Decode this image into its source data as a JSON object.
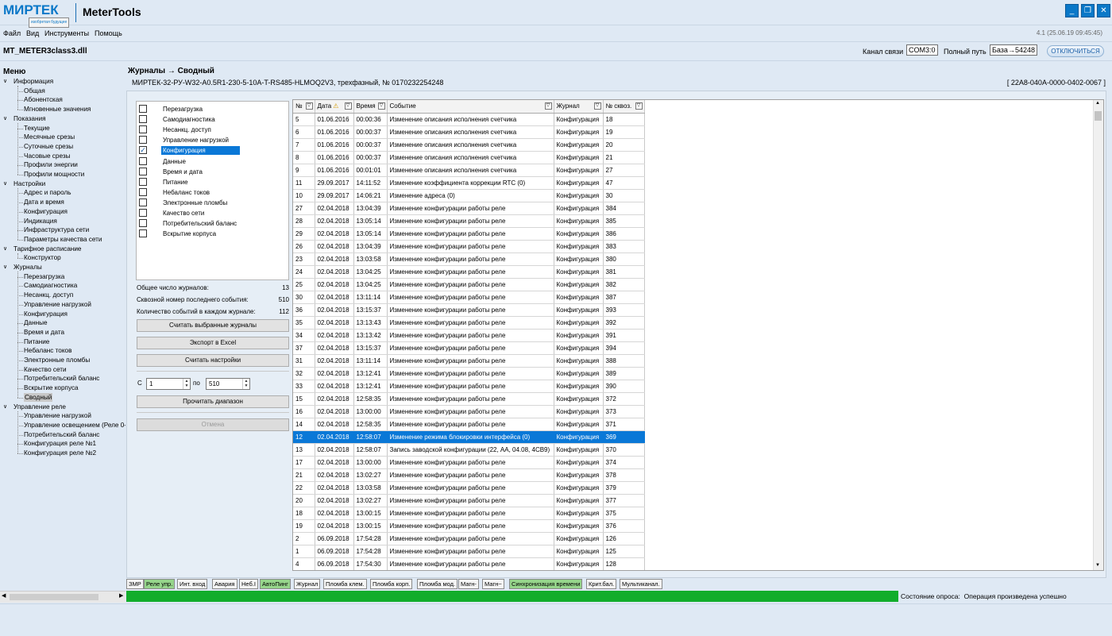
{
  "titlebar": {
    "logo": "МИРТЕК",
    "logo_tagline": "изобретая будущее",
    "app_title": "MeterTools",
    "minimize": "_",
    "maximize": "❐",
    "close": "✕"
  },
  "menubar": {
    "items": [
      "Файл",
      "Вид",
      "Инструменты",
      "Помощь"
    ],
    "version": "4.1 (25.06.19 09:45:45)"
  },
  "dllrow": {
    "dll": "MT_METER3class3.dll",
    "channel_label": "Канал связи",
    "channel_value": "COM3:0",
    "path_label": "Полный путь",
    "path_value": "База→54248",
    "disconnect": "ОТКЛЮЧИТЬСЯ"
  },
  "sidebar": {
    "header": "Меню",
    "tree": [
      {
        "label": "Информация",
        "level": 0,
        "expander": "∨"
      },
      {
        "label": "Общая",
        "level": 1
      },
      {
        "label": "Абонентская",
        "level": 1
      },
      {
        "label": "Мгновенные значения",
        "level": 1
      },
      {
        "label": "Показания",
        "level": 0,
        "expander": "∨"
      },
      {
        "label": "Текущие",
        "level": 1
      },
      {
        "label": "Месячные срезы",
        "level": 1
      },
      {
        "label": "Суточные срезы",
        "level": 1
      },
      {
        "label": "Часовые срезы",
        "level": 1
      },
      {
        "label": "Профили энергии",
        "level": 1
      },
      {
        "label": "Профили мощности",
        "level": 1
      },
      {
        "label": "Настройки",
        "level": 0,
        "expander": "∨"
      },
      {
        "label": "Адрес и пароль",
        "level": 1
      },
      {
        "label": "Дата и время",
        "level": 1
      },
      {
        "label": "Конфигурация",
        "level": 1
      },
      {
        "label": "Индикация",
        "level": 1
      },
      {
        "label": "Инфраструктура сети",
        "level": 1
      },
      {
        "label": "Параметры качества сети",
        "level": 1
      },
      {
        "label": "Тарифное расписание",
        "level": 0,
        "expander": "∨"
      },
      {
        "label": "Конструктор",
        "level": 1
      },
      {
        "label": "Журналы",
        "level": 0,
        "expander": "∨"
      },
      {
        "label": "Перезагрузка",
        "level": 1
      },
      {
        "label": "Самодиагностика",
        "level": 1
      },
      {
        "label": "Несанкц. доступ",
        "level": 1
      },
      {
        "label": "Управление нагрузкой",
        "level": 1
      },
      {
        "label": "Конфигурация",
        "level": 1
      },
      {
        "label": "Данные",
        "level": 1
      },
      {
        "label": "Время и дата",
        "level": 1
      },
      {
        "label": "Питание",
        "level": 1
      },
      {
        "label": "Небаланс токов",
        "level": 1
      },
      {
        "label": "Электронные пломбы",
        "level": 1
      },
      {
        "label": "Качество сети",
        "level": 1
      },
      {
        "label": "Потребительский баланс",
        "level": 1
      },
      {
        "label": "Вскрытие корпуса",
        "level": 1
      },
      {
        "label": "Сводный",
        "level": 1,
        "selected": true
      },
      {
        "label": "Управление реле",
        "level": 0,
        "expander": "∨"
      },
      {
        "label": "Управление нагрузкой",
        "level": 1
      },
      {
        "label": "Управление освещением (Реле 0-4",
        "level": 1
      },
      {
        "label": "Потребительский баланс",
        "level": 1
      },
      {
        "label": "Конфигурация реле №1",
        "level": 1
      },
      {
        "label": "Конфигурация реле №2",
        "level": 1
      }
    ]
  },
  "main": {
    "title": "Журналы → Сводный",
    "meter": "МИРТЕК-32-РУ-W32-A0.5R1-230-5-10A-T-RS485-HLMOQ2V3, трехфазный, № 0170232254248",
    "serial": "[ 22A8-040A-0000-0402-0067 ]"
  },
  "journals": [
    {
      "label": "Перезагрузка",
      "checked": false
    },
    {
      "label": "Самодиагностика",
      "checked": false
    },
    {
      "label": "Несанкц. доступ",
      "checked": false
    },
    {
      "label": "Управление нагрузкой",
      "checked": false
    },
    {
      "label": "Конфигурация",
      "checked": true,
      "selected": true
    },
    {
      "label": "Данные",
      "checked": false
    },
    {
      "label": "Время и дата",
      "checked": false
    },
    {
      "label": "Питание",
      "checked": false
    },
    {
      "label": "Небаланс токов",
      "checked": false
    },
    {
      "label": "Электронные пломбы",
      "checked": false
    },
    {
      "label": "Качество сети",
      "checked": false
    },
    {
      "label": "Потребительский баланс",
      "checked": false
    },
    {
      "label": "Вскрытие корпуса",
      "checked": false
    }
  ],
  "stats": {
    "total_label": "Общее число журналов:",
    "total_value": "13",
    "last_label": "Сквозной номер последнего события:",
    "last_value": "510",
    "each_label": "Количество событий в каждом журнале:",
    "each_value": "112"
  },
  "buttons": {
    "read_selected": "Считать выбранные журналы",
    "export": "Экспорт в Excel",
    "read_settings": "Считать настройки",
    "read_range": "Прочитать диапазон",
    "cancel": "Отмена"
  },
  "range": {
    "from_label": "С",
    "from_value": "1",
    "to_label": "по",
    "to_value": "510",
    "up": "▲",
    "down": "▼"
  },
  "table": {
    "filter_glyph": "▽",
    "warn_glyph": "⚠",
    "columns": [
      "№",
      "Дата",
      "Время",
      "Событие",
      "Журнал",
      "№ сквоз."
    ],
    "rows": [
      [
        "5",
        "01.06.2016",
        "00:00:36",
        "Изменение описания исполнения счетчика",
        "Конфигурация",
        "18"
      ],
      [
        "6",
        "01.06.2016",
        "00:00:37",
        "Изменение описания исполнения счетчика",
        "Конфигурация",
        "19"
      ],
      [
        "7",
        "01.06.2016",
        "00:00:37",
        "Изменение описания исполнения счетчика",
        "Конфигурация",
        "20"
      ],
      [
        "8",
        "01.06.2016",
        "00:00:37",
        "Изменение описания исполнения счетчика",
        "Конфигурация",
        "21"
      ],
      [
        "9",
        "01.06.2016",
        "00:01:01",
        "Изменение описания исполнения счетчика",
        "Конфигурация",
        "27"
      ],
      [
        "11",
        "29.09.2017",
        "14:11:52",
        "Изменение коэффициента коррекции RTC (0)",
        "Конфигурация",
        "47"
      ],
      [
        "10",
        "29.09.2017",
        "14:06:21",
        "Изменение адреса (0)",
        "Конфигурация",
        "30"
      ],
      [
        "27",
        "02.04.2018",
        "13:04:39",
        "Изменение конфигурации работы реле",
        "Конфигурация",
        "384"
      ],
      [
        "28",
        "02.04.2018",
        "13:05:14",
        "Изменение конфигурации работы реле",
        "Конфигурация",
        "385"
      ],
      [
        "29",
        "02.04.2018",
        "13:05:14",
        "Изменение конфигурации работы реле",
        "Конфигурация",
        "386"
      ],
      [
        "26",
        "02.04.2018",
        "13:04:39",
        "Изменение конфигурации работы реле",
        "Конфигурация",
        "383"
      ],
      [
        "23",
        "02.04.2018",
        "13:03:58",
        "Изменение конфигурации работы реле",
        "Конфигурация",
        "380"
      ],
      [
        "24",
        "02.04.2018",
        "13:04:25",
        "Изменение конфигурации работы реле",
        "Конфигурация",
        "381"
      ],
      [
        "25",
        "02.04.2018",
        "13:04:25",
        "Изменение конфигурации работы реле",
        "Конфигурация",
        "382"
      ],
      [
        "30",
        "02.04.2018",
        "13:11:14",
        "Изменение конфигурации работы реле",
        "Конфигурация",
        "387"
      ],
      [
        "36",
        "02.04.2018",
        "13:15:37",
        "Изменение конфигурации работы реле",
        "Конфигурация",
        "393"
      ],
      [
        "35",
        "02.04.2018",
        "13:13:43",
        "Изменение конфигурации работы реле",
        "Конфигурация",
        "392"
      ],
      [
        "34",
        "02.04.2018",
        "13:13:42",
        "Изменение конфигурации работы реле",
        "Конфигурация",
        "391"
      ],
      [
        "37",
        "02.04.2018",
        "13:15:37",
        "Изменение конфигурации работы реле",
        "Конфигурация",
        "394"
      ],
      [
        "31",
        "02.04.2018",
        "13:11:14",
        "Изменение конфигурации работы реле",
        "Конфигурация",
        "388"
      ],
      [
        "32",
        "02.04.2018",
        "13:12:41",
        "Изменение конфигурации работы реле",
        "Конфигурация",
        "389"
      ],
      [
        "33",
        "02.04.2018",
        "13:12:41",
        "Изменение конфигурации работы реле",
        "Конфигурация",
        "390"
      ],
      [
        "15",
        "02.04.2018",
        "12:58:35",
        "Изменение конфигурации работы реле",
        "Конфигурация",
        "372"
      ],
      [
        "16",
        "02.04.2018",
        "13:00:00",
        "Изменение конфигурации работы реле",
        "Конфигурация",
        "373"
      ],
      [
        "14",
        "02.04.2018",
        "12:58:35",
        "Изменение конфигурации работы реле",
        "Конфигурация",
        "371"
      ],
      [
        "12",
        "02.04.2018",
        "12:58:07",
        "Изменение режима блокировки интерфейса (0)",
        "Конфигурация",
        "369"
      ],
      [
        "13",
        "02.04.2018",
        "12:58:07",
        "Запись заводской конфигурации (22, AA, 04.08, 4CB9)",
        "Конфигурация",
        "370"
      ],
      [
        "17",
        "02.04.2018",
        "13:00:00",
        "Изменение конфигурации работы реле",
        "Конфигурация",
        "374"
      ],
      [
        "21",
        "02.04.2018",
        "13:02:27",
        "Изменение конфигурации работы реле",
        "Конфигурация",
        "378"
      ],
      [
        "22",
        "02.04.2018",
        "13:03:58",
        "Изменение конфигурации работы реле",
        "Конфигурация",
        "379"
      ],
      [
        "20",
        "02.04.2018",
        "13:02:27",
        "Изменение конфигурации работы реле",
        "Конфигурация",
        "377"
      ],
      [
        "18",
        "02.04.2018",
        "13:00:15",
        "Изменение конфигурации работы реле",
        "Конфигурация",
        "375"
      ],
      [
        "19",
        "02.04.2018",
        "13:00:15",
        "Изменение конфигурации работы реле",
        "Конфигурация",
        "376"
      ],
      [
        "2",
        "06.09.2018",
        "17:54:28",
        "Изменение конфигурации работы реле",
        "Конфигурация",
        "126"
      ],
      [
        "1",
        "06.09.2018",
        "17:54:28",
        "Изменение конфигурации работы реле",
        "Конфигурация",
        "125"
      ],
      [
        "4",
        "06.09.2018",
        "17:54:30",
        "Изменение конфигурации работы реле",
        "Конфигурация",
        "128"
      ]
    ],
    "selected_row": 25
  },
  "tags": [
    {
      "label": "ЗМР",
      "on": false
    },
    {
      "label": "Реле упр.",
      "on": true
    },
    {
      "label": "Инт. вход",
      "on": false
    },
    {
      "label": "Авария",
      "on": false
    },
    {
      "label": "Неб.I",
      "on": false
    },
    {
      "label": "АвтоПинг",
      "on": true
    },
    {
      "label": "Журнал",
      "on": false
    },
    {
      "label": "Пломба клем.",
      "on": false
    },
    {
      "label": "Пломба корп.",
      "on": false
    },
    {
      "label": "Пломба мод.",
      "on": false
    },
    {
      "label": "Магн-",
      "on": false
    },
    {
      "label": "Магн~",
      "on": false
    },
    {
      "label": "Синхронизация времени",
      "on": true
    },
    {
      "label": "Крит.бал.",
      "on": false
    },
    {
      "label": "Мультиканал.",
      "on": false
    }
  ],
  "status": {
    "label": "Состояние опроса:",
    "text": "Операция произведена успешно",
    "progress": 1.0
  },
  "colors": {
    "accent": "#0a78d7",
    "progress": "#12ad2b",
    "tag_on": "#96d58b"
  }
}
